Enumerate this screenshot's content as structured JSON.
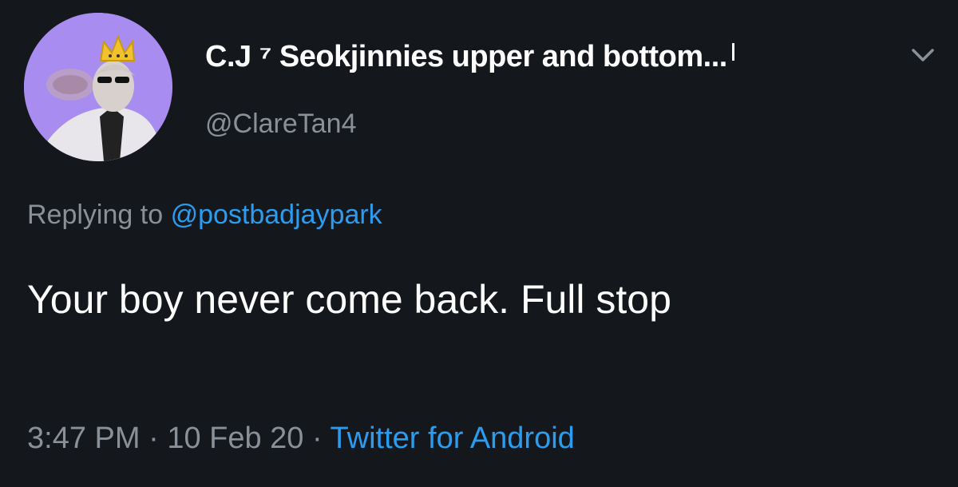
{
  "tweet": {
    "display_name": "C.J ⁷ Seokjinnies upper and bottom...",
    "handle": "@ClareTan4",
    "replying_prefix": "Replying to",
    "replying_to": "@postbadjaypark",
    "text": "Your boy never come back. Full stop",
    "time": "3:47 PM",
    "separator": "·",
    "date": "10 Feb 20",
    "source": "Twitter for Android"
  },
  "icons": {
    "avatar": "profile-avatar",
    "menu": "chevron-down-icon"
  },
  "colors": {
    "background": "#14171c",
    "text": "#ffffff",
    "muted": "#8a9098",
    "link": "#2a9df0",
    "avatar_bg": "#a98cf0"
  }
}
